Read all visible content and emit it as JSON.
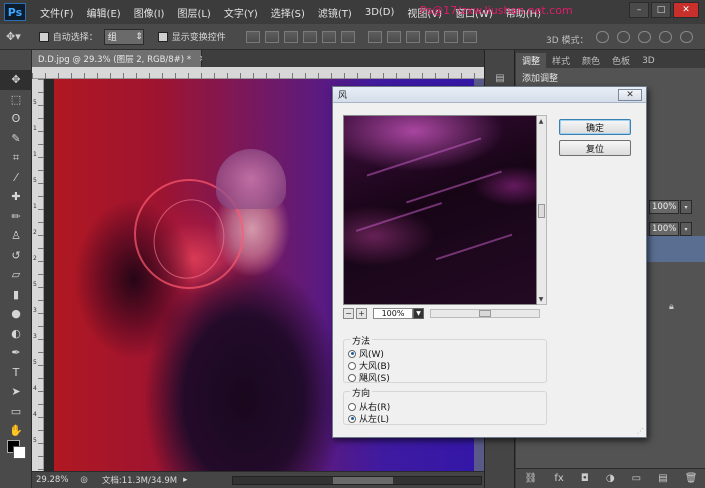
{
  "app": {
    "logo": "Ps",
    "menus": [
      "文件(F)",
      "编辑(E)",
      "图像(I)",
      "图层(L)",
      "文字(Y)",
      "选择(S)",
      "滤镜(T)",
      "3D(D)",
      "视图(V)",
      "窗口(W)",
      "帮助(H)"
    ],
    "watermark": "Ps@17/zxw.liushan.net.com",
    "window_controls": [
      "–",
      "□",
      "✕"
    ]
  },
  "options_bar": {
    "auto_select_label": "自动选择：",
    "auto_select_value": "组",
    "show_transform_label": "显示变换控件",
    "mode_3d_label": "3D 模式："
  },
  "document": {
    "tab_title": "D.D.jpg @ 29.3% (图层 2, RGB/8#) *",
    "tab_close": "×",
    "zoom": "29.28%",
    "doc_info": "文档:11.3M/34.9M"
  },
  "ruler": {
    "left_labels": [
      "5",
      "1",
      "1",
      "5",
      "1",
      "2",
      "2",
      "5",
      "3",
      "3",
      "5",
      "4",
      "4",
      "5"
    ]
  },
  "panels": {
    "tabs": [
      "调整",
      "样式",
      "颜色",
      "色板",
      "3D"
    ],
    "subtitle": "添加调整",
    "opacity_1": "100%",
    "opacity_2": "100%"
  },
  "dialog": {
    "title": "风",
    "close": "✕",
    "ok_label": "确定",
    "reset_label": "复位",
    "zoom_value": "100%",
    "method_title": "方法",
    "methods": [
      {
        "label": "风(W)",
        "checked": true
      },
      {
        "label": "大风(B)",
        "checked": false
      },
      {
        "label": "飓风(S)",
        "checked": false
      }
    ],
    "direction_title": "方向",
    "directions": [
      {
        "label": "从右(R)",
        "checked": false
      },
      {
        "label": "从左(L)",
        "checked": true
      }
    ]
  },
  "colors": {
    "accent": "#2a6fb3",
    "panel_bg": "#535353",
    "dialog_bg": "#f0f0f0"
  }
}
